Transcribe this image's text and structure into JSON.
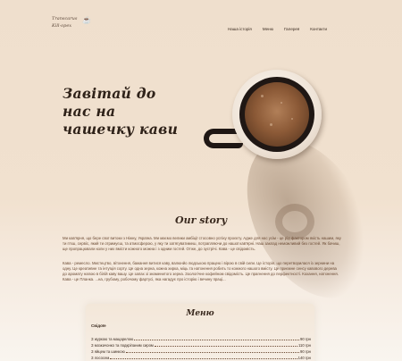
{
  "header": {
    "logo_line1": "Transcarus",
    "logo_line2": "Kill·opex",
    "nav": [
      {
        "label": "Наша історія"
      },
      {
        "label": "Меню"
      },
      {
        "label": "Галерея"
      },
      {
        "label": "Контакти"
      }
    ]
  },
  "hero": {
    "title": "Завітай до нас на чашечку кави"
  },
  "story": {
    "title": "Our story",
    "paragraph1": "Ми кав'ярня, що бере свої витоки з Ніжну, Україна. Ми маємо велики амбіції стосовно успіху проєкту. Адже для нас усім - це рід фактором якість нашим, яку ти п'єш, сервіс, який ти отримуєш, та атмосферою, у яку ти затягуватимеш, потрапляючи до нашої кав'ярні. Наш заклад неможливий без гостей. Як бачиш, ще пропрацювали коли у них вмісти кожного можна і з одним гостей. Отже, до зустрічі. Кава - це свідомість.",
    "paragraph2": "Кава - ремесло. Мистецтво, вітхнення, бажання витися каву, валюнйо людською працею і вірою в свій сили. Це історія, що перетворилася із зернини на одну. Це креативне та інтуїція сорту. Це одна зерна, кожна хирка, міць та натхнення робить то кожного нашого вмісту. Це приємне сенсу кавового дерева до аромату напою в білій каву вашу. Це запах зі знаменитого зерна. Зоологічне кофейном свідомість. Це прагнення до перфектності. Кохання, натхнення. Кава - це Планка. ...на, грубому, робочому фартусі, яка нагадує про історію і вечину праці..."
  },
  "menu": {
    "title": "Меню",
    "section": "Свідоїе",
    "items": [
      {
        "name": "З журкою та мацарелою",
        "price": "90 грн"
      },
      {
        "name": "З мозкачонко та подкріпаним сиром",
        "price": "110 грн"
      },
      {
        "name": "З яйцем та шинкою",
        "price": "90 грн"
      },
      {
        "name": "З лососем",
        "price": "140 грн"
      }
    ]
  },
  "colors": {
    "background": "#efdfcd",
    "text_dark": "#3a2a1f",
    "text_brown": "#6b4a33",
    "cup": "#1f1714"
  }
}
